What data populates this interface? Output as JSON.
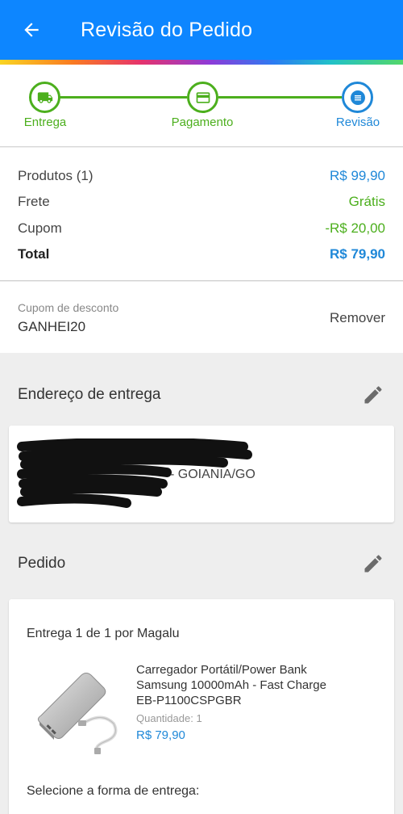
{
  "header": {
    "title": "Revisão do Pedido",
    "bg_color": "#0d86ff"
  },
  "stepper": {
    "steps": [
      {
        "label": "Entrega",
        "state": "done",
        "icon": "truck-icon",
        "color": "#4caf1d"
      },
      {
        "label": "Pagamento",
        "state": "done",
        "icon": "card-icon",
        "color": "#4caf1d"
      },
      {
        "label": "Revisão",
        "state": "current",
        "icon": "list-icon",
        "color": "#1f88d8"
      }
    ]
  },
  "summary": {
    "products_label": "Produtos (1)",
    "products_value": "R$ 99,90",
    "shipping_label": "Frete",
    "shipping_value": "Grátis",
    "coupon_label": "Cupom",
    "coupon_value": "-R$ 20,00",
    "total_label": "Total",
    "total_value": "R$ 79,90"
  },
  "coupon": {
    "label": "Cupom de desconto",
    "code": "GANHEI20",
    "remove_label": "Remover"
  },
  "address": {
    "title": "Endereço de entrega",
    "city": "- GOIANIA/GO"
  },
  "order": {
    "title": "Pedido",
    "delivery_by": "Entrega 1 de 1 por Magalu",
    "product_name": "Carregador Portátil/Power Bank Samsung 10000mAh - Fast Charge EB-P1100CSPGBR",
    "quantity_label": "Quantidade:  1",
    "price": "R$ 79,90",
    "shipping_prompt": "Selecione a forma de entrega:"
  }
}
